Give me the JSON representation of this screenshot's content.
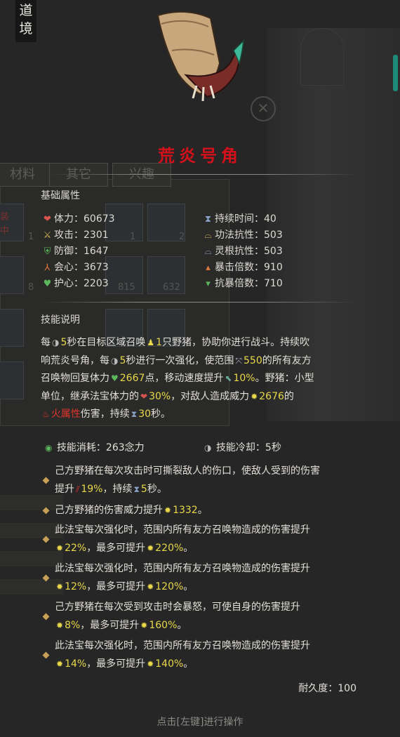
{
  "corner_tag": {
    "line1": "道",
    "line2": "境"
  },
  "background": {
    "tabs": [
      "材料",
      "其它",
      "兴趣"
    ],
    "side_label_1": "装",
    "side_label_2": "中",
    "slot_counts": [
      "1",
      "1",
      "2",
      "8",
      "815",
      "632"
    ]
  },
  "item": {
    "name": "荒炎号角",
    "base_section_title": "基础属性",
    "stats_left": [
      {
        "label": "体力：60673",
        "icon": "heart-icon",
        "color": "#d9534f"
      },
      {
        "label": "攻击：2301",
        "icon": "crossed-swords-icon",
        "color": "#d8b45a"
      },
      {
        "label": "防御：1647",
        "icon": "shield-icon",
        "color": "#5cb85c"
      },
      {
        "label": "会心：3673",
        "icon": "tri-blade-icon",
        "color": "#e07a3a"
      },
      {
        "label": "护心：2203",
        "icon": "heart-shield-icon",
        "color": "#5cb85c"
      }
    ],
    "stats_right": [
      {
        "label": "持续时间：40",
        "icon": "hourglass-icon",
        "color": "#8aa4c8"
      },
      {
        "label": "功法抗性：503",
        "icon": "arc-icon",
        "color": "#d8b45a"
      },
      {
        "label": "灵根抗性：503",
        "icon": "arc-icon",
        "color": "#8aa4c8"
      },
      {
        "label": "暴击倍数：910",
        "icon": "triangles-up-icon",
        "color": "#e07a3a"
      },
      {
        "label": "抗暴倍数：710",
        "icon": "triangles-down-icon",
        "color": "#5cb85c"
      }
    ],
    "skill_section_title": "技能说明",
    "skill": {
      "l1a": "每",
      "v_interval": "5",
      "l1b": "秒在目标区域召唤",
      "v_count": "1",
      "l1c": "只野猪，协助你进行战斗。持续吹",
      "l2a": "响荒炎号角，每",
      "v_enhance": "5",
      "l2b": "秒进行一次强化，使范围",
      "v_range": "550",
      "l2c": "的所有友方",
      "l3a": "召唤物回复体力",
      "v_heal": "2667",
      "l3b": "点，移动速度提升",
      "v_speed": "10%",
      "l3c": "。野猪：小型",
      "l4a": "单位，继承法宝体力的",
      "v_inherit": "30%",
      "l4b": "，对敌人造成威力",
      "v_power": "2676",
      "l4c": "的",
      "fire_attr": "火属性",
      "l5a": "伤害，持续",
      "v_duration": "30",
      "l5b": "秒。"
    },
    "cost_label": "技能消耗：263念力",
    "cooldown_label": "技能冷却：5秒",
    "effects": [
      {
        "l1": "己方野猪在每次攻击时可撕裂敌人的伤口，使敌人受到的伤害",
        "l2a": "提升",
        "v1": "19%",
        "l2b": "，持续",
        "v2": "5",
        "l2c": "秒。"
      },
      {
        "l1a": "己方野猪的伤害威力提升",
        "v1": "1332",
        "l1b": "。"
      },
      {
        "l1": "此法宝每次强化时，范围内所有友方召唤物造成的伤害提升",
        "v1": "22%",
        "mid": "，最多可提升",
        "v2": "220%",
        "end": "。"
      },
      {
        "l1": "此法宝每次强化时，范围内所有友方召唤物造成的伤害提升",
        "v1": "12%",
        "mid": "，最多可提升",
        "v2": "120%",
        "end": "。"
      },
      {
        "l1": "己方野猪在每次受到攻击时会暴怒，可使自身的伤害提升",
        "v1": "8%",
        "mid": "，最多可提升",
        "v2": "160%",
        "end": "。"
      },
      {
        "l1": "此法宝每次强化时，范围内所有友方召唤物造成的伤害提升",
        "v1": "14%",
        "mid": "，最多可提升",
        "v2": "140%",
        "end": "。"
      }
    ],
    "durability": "耐久度：100"
  },
  "footer_hint": "点击[左键]进行操作",
  "colors": {
    "title_red": "#d4101a",
    "value_yellow": "#e8d84a",
    "fire_red": "#e0342c",
    "accent_teal": "#1d8a7a"
  }
}
